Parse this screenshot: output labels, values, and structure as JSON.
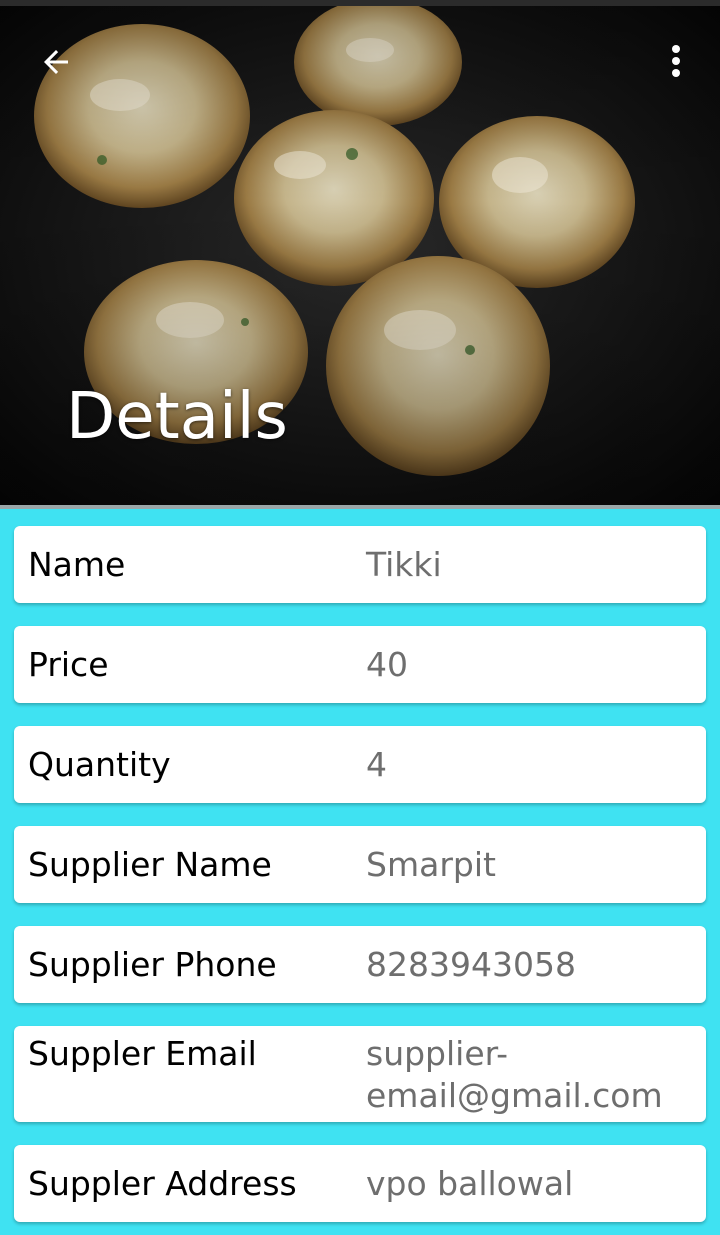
{
  "header": {
    "title": "Details",
    "back_icon": "arrow-left-icon",
    "menu_icon": "more-vert-icon",
    "image_subject": "fried potato tikkis in a dark pan"
  },
  "details": [
    {
      "label": "Name",
      "value": "Tikki"
    },
    {
      "label": "Price",
      "value": "40"
    },
    {
      "label": "Quantity",
      "value": "4"
    },
    {
      "label": "Supplier Name",
      "value": "Smarpit"
    },
    {
      "label": "Supplier Phone",
      "value": "8283943058"
    },
    {
      "label": "Suppler Email",
      "value_line1": "supplier-",
      "value_line2": "email@gmail.com"
    },
    {
      "label": "Suppler Address",
      "value": "vpo ballowal"
    }
  ],
  "colors": {
    "background": "#3fe2f2",
    "card": "#ffffff",
    "label_text": "#000000",
    "value_text": "#6e6e6e",
    "title_text": "#ffffff"
  }
}
